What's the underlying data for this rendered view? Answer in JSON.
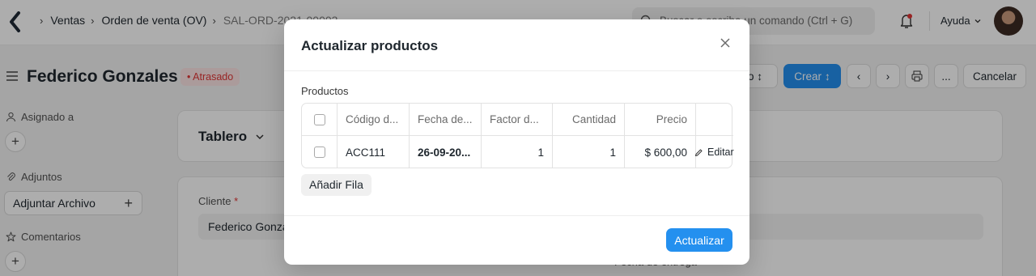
{
  "navbar": {
    "breadcrumbs": [
      "Ventas",
      "Orden de venta (OV)",
      "SAL-ORD-2021-00003"
    ],
    "search_placeholder": "Buscar o escriba un comando (Ctrl + G)",
    "help_label": "Ayuda"
  },
  "page": {
    "title": "Federico Gonzales",
    "status": "Atrasado",
    "status_color": "#e03636",
    "actions": {
      "create_label": "Crear",
      "cancel_label": "Cancelar",
      "more_label": "..."
    }
  },
  "sidebar": {
    "assigned_label": "Asignado a",
    "attachments_label": "Adjuntos",
    "attach_button": "Adjuntar Archivo",
    "comments_label": "Comentarios"
  },
  "main": {
    "dashboard_label": "Tablero",
    "customer_label": "Cliente",
    "customer_value": "Federico Gonzales",
    "delivery_label": "Fecha de entrega"
  },
  "modal": {
    "title": "Actualizar productos",
    "section_label": "Productos",
    "columns": [
      "Código d...",
      "Fecha de...",
      "Factor d...",
      "Cantidad",
      "Precio"
    ],
    "rows": [
      {
        "code": "ACC111",
        "date": "26-09-20...",
        "factor": "1",
        "qty": "1",
        "price": "$ 600,00",
        "edit": "Editar"
      }
    ],
    "add_row_label": "Añadir Fila",
    "submit_label": "Actualizar"
  },
  "colors": {
    "accent": "#2490ef",
    "danger": "#e03636"
  }
}
